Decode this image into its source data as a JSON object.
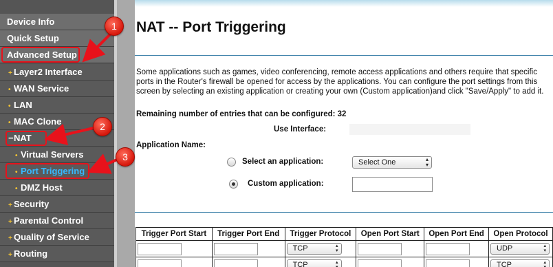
{
  "sidebar": {
    "items": [
      {
        "label": "Device Info"
      },
      {
        "label": "Quick Setup"
      },
      {
        "label": "Advanced Setup"
      },
      {
        "label": "Layer2 Interface"
      },
      {
        "label": "WAN Service"
      },
      {
        "label": "LAN"
      },
      {
        "label": "MAC Clone"
      },
      {
        "label": "NAT"
      },
      {
        "label": "Virtual Servers"
      },
      {
        "label": "Port Triggering"
      },
      {
        "label": "DMZ Host"
      },
      {
        "label": "Security"
      },
      {
        "label": "Parental Control"
      },
      {
        "label": "Quality of Service"
      },
      {
        "label": "Routing"
      }
    ]
  },
  "page": {
    "title": "NAT -- Port Triggering",
    "intro": "Some applications such as games, video conferencing, remote access applications and others require that specific ports in the Router's firewall be opened for access by the applications. You can configure the port settings from this screen by selecting an existing application or creating your own (Custom application)and click \"Save/Apply\" to add it.",
    "remaining": "Remaining number of entries that can be configured: 32",
    "use_interface_label": "Use Interface:",
    "application_name_label": "Application Name:",
    "select_app_label": "Select an application:",
    "select_app_value": "Select One",
    "custom_app_label": "Custom application:"
  },
  "table": {
    "headers": [
      "Trigger Port Start",
      "Trigger Port End",
      "Trigger Protocol",
      "Open Port Start",
      "Open Port End",
      "Open Protocol"
    ],
    "rows": [
      {
        "trigger_protocol": "TCP",
        "open_protocol": "UDP"
      },
      {
        "trigger_protocol": "TCP",
        "open_protocol": "TCP"
      }
    ]
  },
  "annotations": {
    "step1": "1",
    "step2": "2",
    "step3": "3",
    "color": "#e8121b"
  },
  "colors": {
    "sidebar_bg": "#555555",
    "active_item": "#37b8ff",
    "bullet": "#f2c233",
    "rule": "#3b7fa8"
  }
}
